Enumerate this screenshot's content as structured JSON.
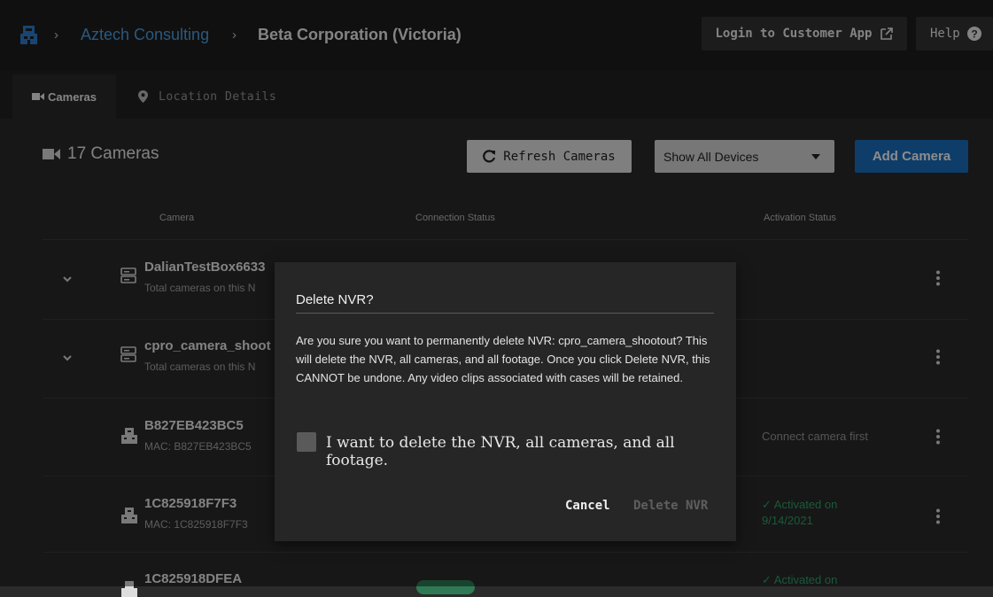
{
  "breadcrumb": {
    "items": [
      "Aztech Consulting",
      "Beta Corporation (Victoria)"
    ],
    "separator": "›"
  },
  "header": {
    "login_label": "Login to Customer App",
    "help_label": "Help"
  },
  "tabs": [
    {
      "label": "Cameras",
      "icon": "video-camera-icon",
      "active": true
    },
    {
      "label": "Location Details",
      "icon": "map-pin-icon",
      "active": false
    }
  ],
  "cameras": {
    "count_label": "17 Cameras",
    "refresh_label": "Refresh Cameras",
    "filter_value": "Show All Devices",
    "add_label": "Add Camera",
    "columns": [
      "Camera",
      "Connection Status",
      "Activation Status"
    ],
    "rows": [
      {
        "name": "DalianTestBox6633",
        "sub": "Total cameras on this N",
        "type": "nvr",
        "activation": ""
      },
      {
        "name": "cpro_camera_shoot",
        "sub": "Total cameras on this N",
        "type": "nvr",
        "activation": ""
      },
      {
        "name": "B827EB423BC5",
        "sub": "MAC: B827EB423BC5",
        "type": "camera",
        "activation": "Connect camera first"
      },
      {
        "name": "1C825918F7F3",
        "sub": "MAC: 1C825918F7F3",
        "type": "camera",
        "activation": "Activated on",
        "activation_date": "9/14/2021"
      },
      {
        "name": "1C825918DFEA",
        "sub": "",
        "type": "camera",
        "activation": "Activated on"
      }
    ]
  },
  "modal": {
    "title": "Delete NVR?",
    "body": "Are you sure you want to permanently delete NVR: cpro_camera_shootout? This will delete the NVR, all cameras, and all footage. Once you click Delete NVR, this CANNOT be undone. Any video clips associated with cases will be retained.",
    "checkbox_label": "I want to delete the NVR, all cameras, and all footage.",
    "cancel_label": "Cancel",
    "delete_label": "Delete NVR"
  },
  "colors": {
    "accent": "#1c70c0",
    "link": "#4ea1e3",
    "success": "#2fa36b"
  }
}
